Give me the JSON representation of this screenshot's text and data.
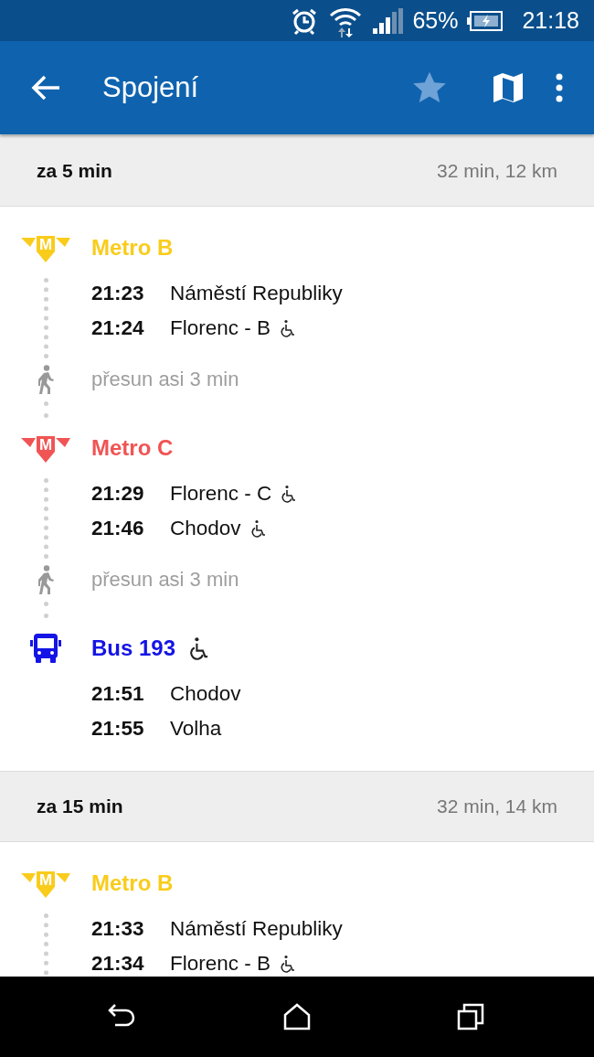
{
  "status_bar": {
    "battery": "65%",
    "time": "21:18"
  },
  "app_bar": {
    "title": "Spojení",
    "favorite": false
  },
  "connections": [
    {
      "departs_in": "za 5 min",
      "summary": "32 min, 12 km",
      "legs": [
        {
          "kind": "metro",
          "name": "Metro B",
          "logo_letter": "M",
          "color": "#f9cc1c",
          "stops": [
            {
              "time": "21:23",
              "station": "Náměstí Republiky",
              "accessible": false
            },
            {
              "time": "21:24",
              "station": "Florenc - B",
              "accessible": true
            }
          ]
        },
        {
          "kind": "walk",
          "text": "přesun asi 3 min"
        },
        {
          "kind": "metro",
          "name": "Metro C",
          "logo_letter": "M",
          "color": "#f05454",
          "stops": [
            {
              "time": "21:29",
              "station": "Florenc - C",
              "accessible": true
            },
            {
              "time": "21:46",
              "station": "Chodov",
              "accessible": true
            }
          ]
        },
        {
          "kind": "walk",
          "text": "přesun asi 3 min"
        },
        {
          "kind": "bus",
          "name": "Bus 193",
          "color": "#1414e6",
          "accessible": true,
          "stops": [
            {
              "time": "21:51",
              "station": "Chodov",
              "accessible": false
            },
            {
              "time": "21:55",
              "station": "Volha",
              "accessible": false
            }
          ]
        }
      ]
    },
    {
      "departs_in": "za 15 min",
      "summary": "32 min, 14 km",
      "legs": [
        {
          "kind": "metro",
          "name": "Metro B",
          "logo_letter": "M",
          "color": "#f9cc1c",
          "stops": [
            {
              "time": "21:33",
              "station": "Náměstí Republiky",
              "accessible": false
            },
            {
              "time": "21:34",
              "station": "Florenc - B",
              "accessible": true
            }
          ]
        }
      ]
    }
  ]
}
